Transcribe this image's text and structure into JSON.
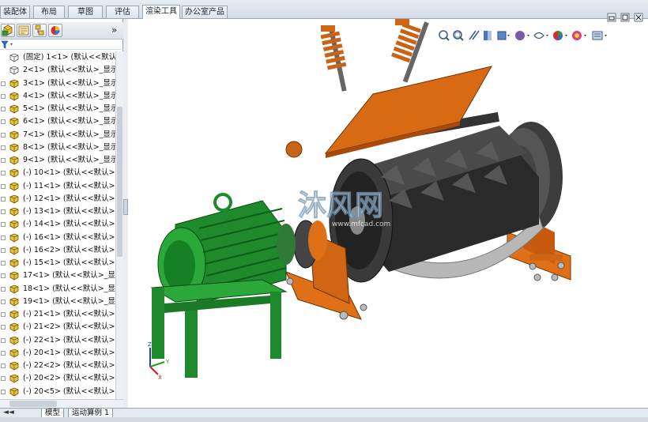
{
  "command_tabs": [
    {
      "label": "装配体",
      "active": false
    },
    {
      "label": "布局",
      "active": false
    },
    {
      "label": "草图",
      "active": false
    },
    {
      "label": "评估",
      "active": false
    },
    {
      "label": "渲染工具",
      "active": true
    },
    {
      "label": "办公室产品",
      "active": false
    }
  ],
  "left_panel": {
    "collapse_glyph": "»",
    "toolbar_icons": [
      "feature-manager-icon",
      "property-manager-icon",
      "configuration-manager-icon",
      "display-manager-icon"
    ],
    "filter_icon": "filter-icon",
    "tree": [
      {
        "label": "(固定) 1<1> (默认<<默认",
        "icon": "part-fixed-icon"
      },
      {
        "label": "2<1> (默认<<默认>_显示",
        "icon": "part-fixed-icon"
      },
      {
        "label": "3<1> (默认<<默认>_显示",
        "icon": "part-icon"
      },
      {
        "label": "4<1> (默认<<默认>_显示",
        "icon": "part-icon"
      },
      {
        "label": "5<1> (默认<<默认>_显示",
        "icon": "part-icon"
      },
      {
        "label": "6<1> (默认<<默认>_显示",
        "icon": "part-icon"
      },
      {
        "label": "7<1> (默认<<默认>_显示",
        "icon": "part-icon"
      },
      {
        "label": "8<1> (默认<<默认>_显示",
        "icon": "part-icon"
      },
      {
        "label": "9<1> (默认<<默认>_显示",
        "icon": "part-icon"
      },
      {
        "label": "(-) 10<1> (默认<<默认>",
        "icon": "part-icon"
      },
      {
        "label": "(-) 11<1> (默认<<默认>",
        "icon": "part-icon"
      },
      {
        "label": "(-) 12<1> (默认<<默认>",
        "icon": "part-icon"
      },
      {
        "label": "(-) 13<1> (默认<<默认>",
        "icon": "part-icon"
      },
      {
        "label": "(-) 14<1> (默认<<默认>",
        "icon": "part-icon"
      },
      {
        "label": "(-) 16<1> (默认<<默认>",
        "icon": "part-icon"
      },
      {
        "label": "(-) 16<2> (默认<<默认>",
        "icon": "part-icon"
      },
      {
        "label": "(-) 15<1> (默认<<默认>",
        "icon": "part-icon"
      },
      {
        "label": "17<1> (默认<<默认>_显",
        "icon": "part-icon"
      },
      {
        "label": "18<1> (默认<<默认>_显",
        "icon": "part-icon"
      },
      {
        "label": "19<1> (默认<<默认>_显",
        "icon": "part-icon"
      },
      {
        "label": "(-) 21<1> (默认<<默认>",
        "icon": "part-icon"
      },
      {
        "label": "(-) 21<2> (默认<<默认>",
        "icon": "part-icon"
      },
      {
        "label": "(-) 22<1> (默认<<默认>",
        "icon": "part-icon"
      },
      {
        "label": "(-) 20<1> (默认<<默认>",
        "icon": "part-icon"
      },
      {
        "label": "(-) 22<2> (默认<<默认>",
        "icon": "part-icon"
      },
      {
        "label": "(-) 20<2> (默认<<默认>",
        "icon": "part-icon"
      },
      {
        "label": "(-) 20<5> (默认<<默认>",
        "icon": "part-icon"
      }
    ]
  },
  "viewport": {
    "watermark_text": "沐风网",
    "watermark_url": "www.mfcad.com",
    "triad_labels": {
      "x": "X",
      "y": "Y",
      "z": "Z"
    },
    "heads_up_icons": [
      "zoom-to-fit-icon",
      "zoom-area-icon",
      "previous-view-icon",
      "section-view-icon",
      "view-orientation-icon",
      "display-style-icon",
      "hide-show-icon",
      "edit-appearance-icon",
      "apply-scene-icon",
      "view-settings-icon"
    ],
    "window_controls": [
      "restore-icon",
      "maximize-icon",
      "close-icon"
    ],
    "colors": {
      "frame": "#e07018",
      "motor": "#1f8a2c",
      "rotor": "#2a2a2a",
      "screen": "#b8b8b8"
    }
  },
  "bottom_tabs": [
    {
      "label": "模型",
      "active": true
    },
    {
      "label": "运动算例 1",
      "active": false
    }
  ]
}
